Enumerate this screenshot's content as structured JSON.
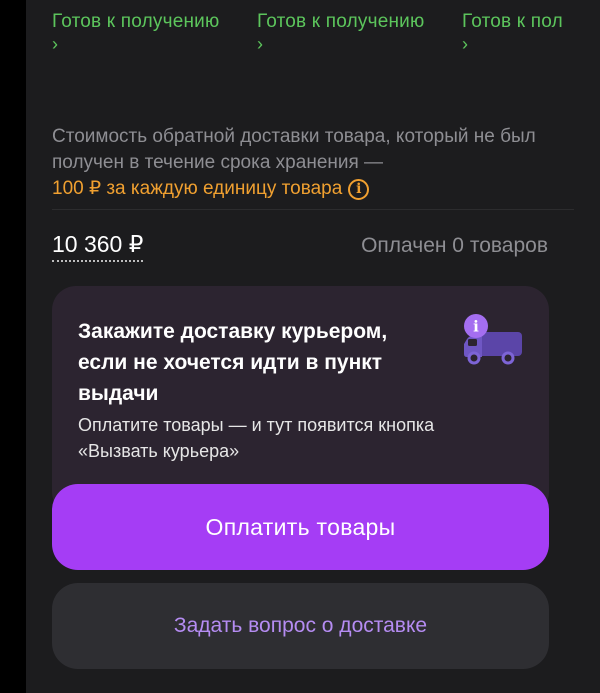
{
  "statuses": [
    {
      "label": "Готов к получению",
      "chevron": "›"
    },
    {
      "label": "Готов к получению",
      "chevron": "›"
    },
    {
      "label": "Готов к пол",
      "chevron": "›"
    }
  ],
  "storage_note": {
    "text": "Стоимость обратной доставки товара, который не был получен в течение срока хранения —",
    "link": "100 ₽ за каждую единицу товара",
    "info_glyph": "i"
  },
  "summary": {
    "amount": "10 360 ₽",
    "paid_status": "Оплачен 0 товаров"
  },
  "promo": {
    "title": "Закажите доставку курьером, если не хочется идти в пункт выдачи",
    "subtitle": "Оплатите товары — и тут появится кнопка «Вызвать курьера»",
    "icon": "delivery-truck-icon",
    "badge_glyph": "i"
  },
  "actions": {
    "pay_label": "Оплатить товары",
    "ask_label": "Задать вопрос о доставке"
  },
  "colors": {
    "status_green": "#5cc55c",
    "accent_orange": "#f0a030",
    "primary_purple": "#a53df5",
    "secondary_text_purple": "#b58cf2",
    "background": "#1c1c1e"
  }
}
